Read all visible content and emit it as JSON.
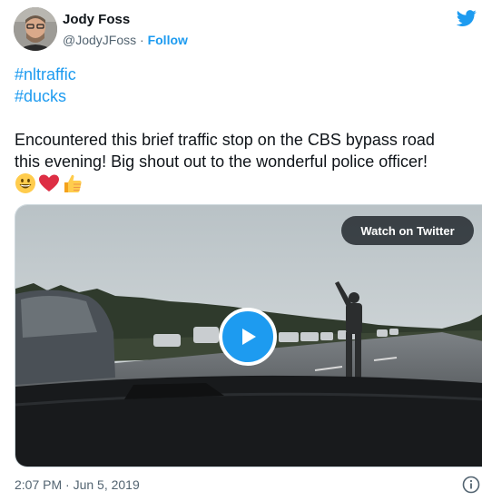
{
  "author": {
    "name": "Jody Foss",
    "handle": "@JodyJFoss",
    "separator": "·",
    "follow_label": "Follow",
    "avatar_icon": "profile-photo",
    "platform_icon": "twitter-bird-icon"
  },
  "tweet": {
    "hashtags": [
      "#nltraffic",
      "#ducks"
    ],
    "text_line1": "Encountered this brief traffic stop on the CBS bypass road",
    "text_line2": "this evening! Big shout out to the wonderful police officer!",
    "emojis": [
      "grinning-face",
      "red-heart",
      "thumbs-up"
    ]
  },
  "media": {
    "watch_label": "Watch on Twitter",
    "play_icon": "play-icon"
  },
  "footer": {
    "timestamp": "2:07 PM · Jun 5, 2019",
    "info_icon": "info-icon"
  },
  "colors": {
    "accent": "#1d9bf0",
    "text": "#0f1419",
    "secondary": "#536471"
  }
}
